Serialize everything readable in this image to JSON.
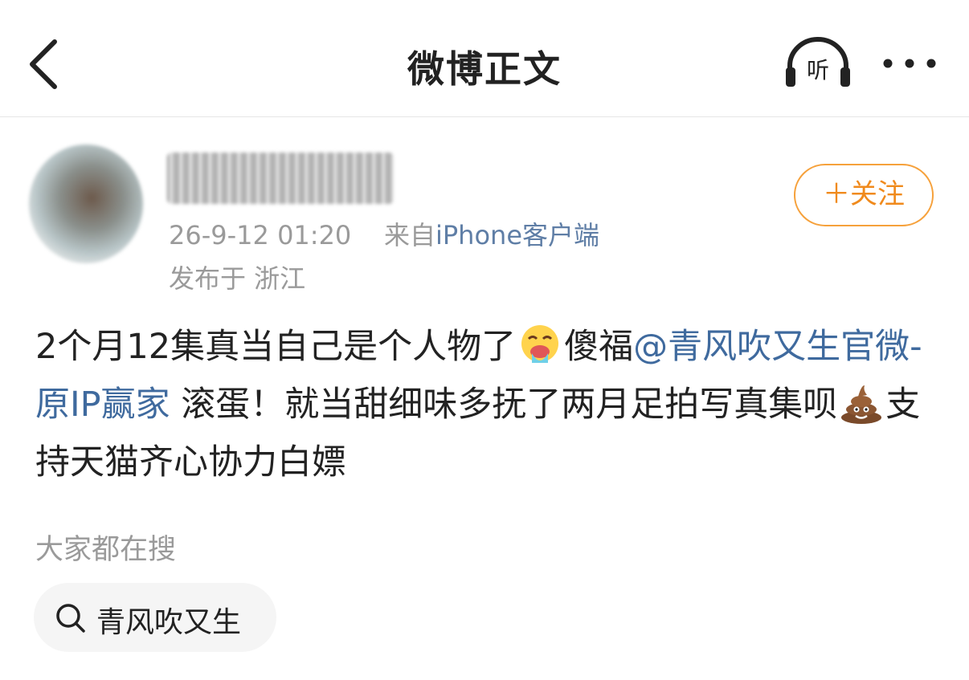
{
  "nav": {
    "title": "微博正文",
    "listen_label": "听"
  },
  "author": {
    "timestamp": "26-9-12 01:20",
    "source_prefix": "来自",
    "source_device": "iPhone客户端",
    "location": "发布于 浙江",
    "follow_label": "＋关注"
  },
  "post": {
    "segment1": "2个月12集真当自己是个人物了",
    "segment2": "傻福",
    "mention": "@青风吹又生官微-原IP赢家",
    "segment3": " 滚蛋！就当甜细味多抚了两月足拍写真集呗",
    "segment4": "支持天猫齐心协力白嫖"
  },
  "search_section": {
    "title": "大家都在搜",
    "chip_label": "青风吹又生"
  },
  "icons": {
    "back": "chevron-left-icon",
    "listen": "headphones-icon",
    "more": "more-dots-icon",
    "emoji1": "vomiting-face-emoji",
    "emoji2": "poop-emoji",
    "search": "search-icon"
  },
  "colors": {
    "accent_orange": "#f08a1c",
    "link_blue": "#3f6a9e",
    "meta_gray": "#9a9a9a"
  }
}
